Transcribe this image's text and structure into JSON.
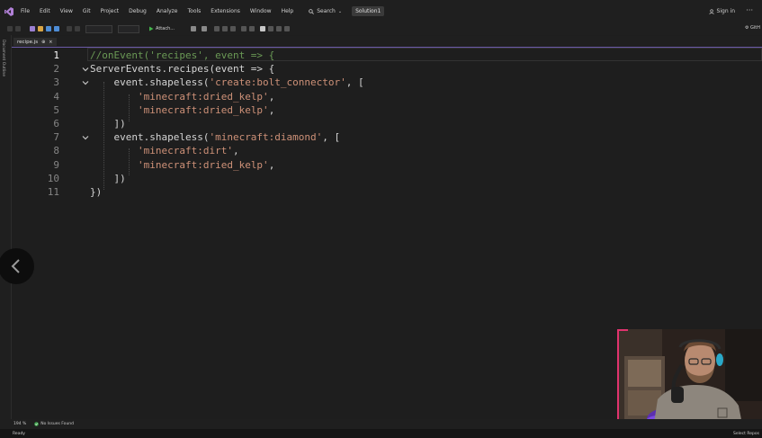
{
  "menubar": {
    "items": [
      "File",
      "Edit",
      "View",
      "Git",
      "Project",
      "Debug",
      "Analyze",
      "Tools",
      "Extensions",
      "Window",
      "Help"
    ],
    "search_label": "Search",
    "solution_label": "Solution1",
    "signin_label": "Sign in"
  },
  "toolbar": {
    "attach_label": "Attach...",
    "github_label": "GitH"
  },
  "side_panel": {
    "label": "Document Outline"
  },
  "tab": {
    "filename": "recipe.js"
  },
  "editor": {
    "current_line": 1,
    "lines": [
      {
        "n": "1",
        "tokens": [
          {
            "t": "//onEvent('recipes', event => {",
            "c": "comment"
          }
        ]
      },
      {
        "n": "2",
        "tokens": [
          {
            "t": "ServerEvents.recipes(event => {",
            "c": "ident"
          }
        ]
      },
      {
        "n": "3",
        "tokens": [
          {
            "t": "    event.shapeless(",
            "c": "ident"
          },
          {
            "t": "'create:bolt_connector'",
            "c": "str"
          },
          {
            "t": ", [",
            "c": "punc"
          }
        ]
      },
      {
        "n": "4",
        "tokens": [
          {
            "t": "        ",
            "c": "ident"
          },
          {
            "t": "'minecraft:dried_kelp'",
            "c": "str"
          },
          {
            "t": ",",
            "c": "punc"
          }
        ]
      },
      {
        "n": "5",
        "tokens": [
          {
            "t": "        ",
            "c": "ident"
          },
          {
            "t": "'minecraft:dried_kelp'",
            "c": "str"
          },
          {
            "t": ",",
            "c": "punc"
          }
        ]
      },
      {
        "n": "6",
        "tokens": [
          {
            "t": "    ])",
            "c": "punc"
          }
        ]
      },
      {
        "n": "7",
        "tokens": [
          {
            "t": "    event.shapeless(",
            "c": "ident"
          },
          {
            "t": "'minecraft:diamond'",
            "c": "str"
          },
          {
            "t": ", [",
            "c": "punc"
          }
        ]
      },
      {
        "n": "8",
        "tokens": [
          {
            "t": "        ",
            "c": "ident"
          },
          {
            "t": "'minecraft:dirt'",
            "c": "str"
          },
          {
            "t": ",",
            "c": "punc"
          }
        ]
      },
      {
        "n": "9",
        "tokens": [
          {
            "t": "        ",
            "c": "ident"
          },
          {
            "t": "'minecraft:dried_kelp'",
            "c": "str"
          },
          {
            "t": ",",
            "c": "punc"
          }
        ]
      },
      {
        "n": "10",
        "tokens": [
          {
            "t": "    ])",
            "c": "punc"
          }
        ]
      },
      {
        "n": "11",
        "tokens": [
          {
            "t": "})",
            "c": "punc"
          }
        ]
      }
    ],
    "fold_lines": [
      2,
      3,
      7
    ]
  },
  "statusbar": {
    "zoom": "194 %",
    "issues": "No Issues Found"
  },
  "bottombar": {
    "ready": "Ready",
    "select_repo": "Select Repos"
  },
  "colors": {
    "comment": "#6a9955",
    "string": "#ce9178",
    "identifier": "#d4d4d4",
    "line_number": "#858585",
    "accent": "#6b5aa8",
    "webcam_border": "#e0336e"
  }
}
